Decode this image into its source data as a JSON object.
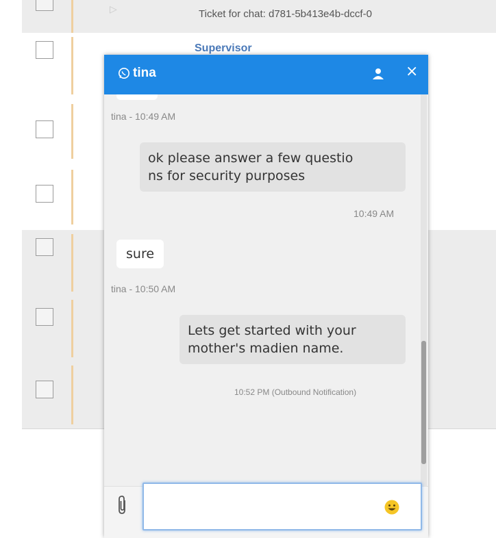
{
  "ticket_list": {
    "top_ticket_text": "Ticket for chat: d781-5b413e4b-dccf-0",
    "supervisor_label": "Supervisor"
  },
  "chat": {
    "contact_name": "tina",
    "header_icons": [
      "whatsapp-icon",
      "user-icon",
      "close-icon"
    ],
    "close_glyph": "×",
    "messages": [
      {
        "direction": "incoming",
        "meta": "tina - 10:49 AM"
      },
      {
        "direction": "outgoing",
        "text": "ok please answer a few questio ns for security purposes",
        "lines": [
          "ok please answer a few questio",
          "ns for security purposes"
        ],
        "meta": "10:49 AM"
      },
      {
        "direction": "incoming",
        "text": "sure",
        "meta": "tina - 10:50 AM"
      },
      {
        "direction": "outgoing",
        "text": "Lets get started with your mother's madien name.",
        "lines": [
          "Lets get started with your",
          "mother's madien name."
        ],
        "meta": "10:52 PM (Outbound Notification)"
      }
    ],
    "composer": {
      "value": "",
      "icons": [
        "paperclip-icon",
        "emoji-icon"
      ]
    }
  },
  "colors": {
    "header": "#1e88e5",
    "chat_bg": "#f0f0f0",
    "outgoing_bubble": "#e2e2e2",
    "incoming_bubble": "#ffffff",
    "row_stripe": "#efcf9f",
    "supervisor_link": "#4a79b8"
  }
}
